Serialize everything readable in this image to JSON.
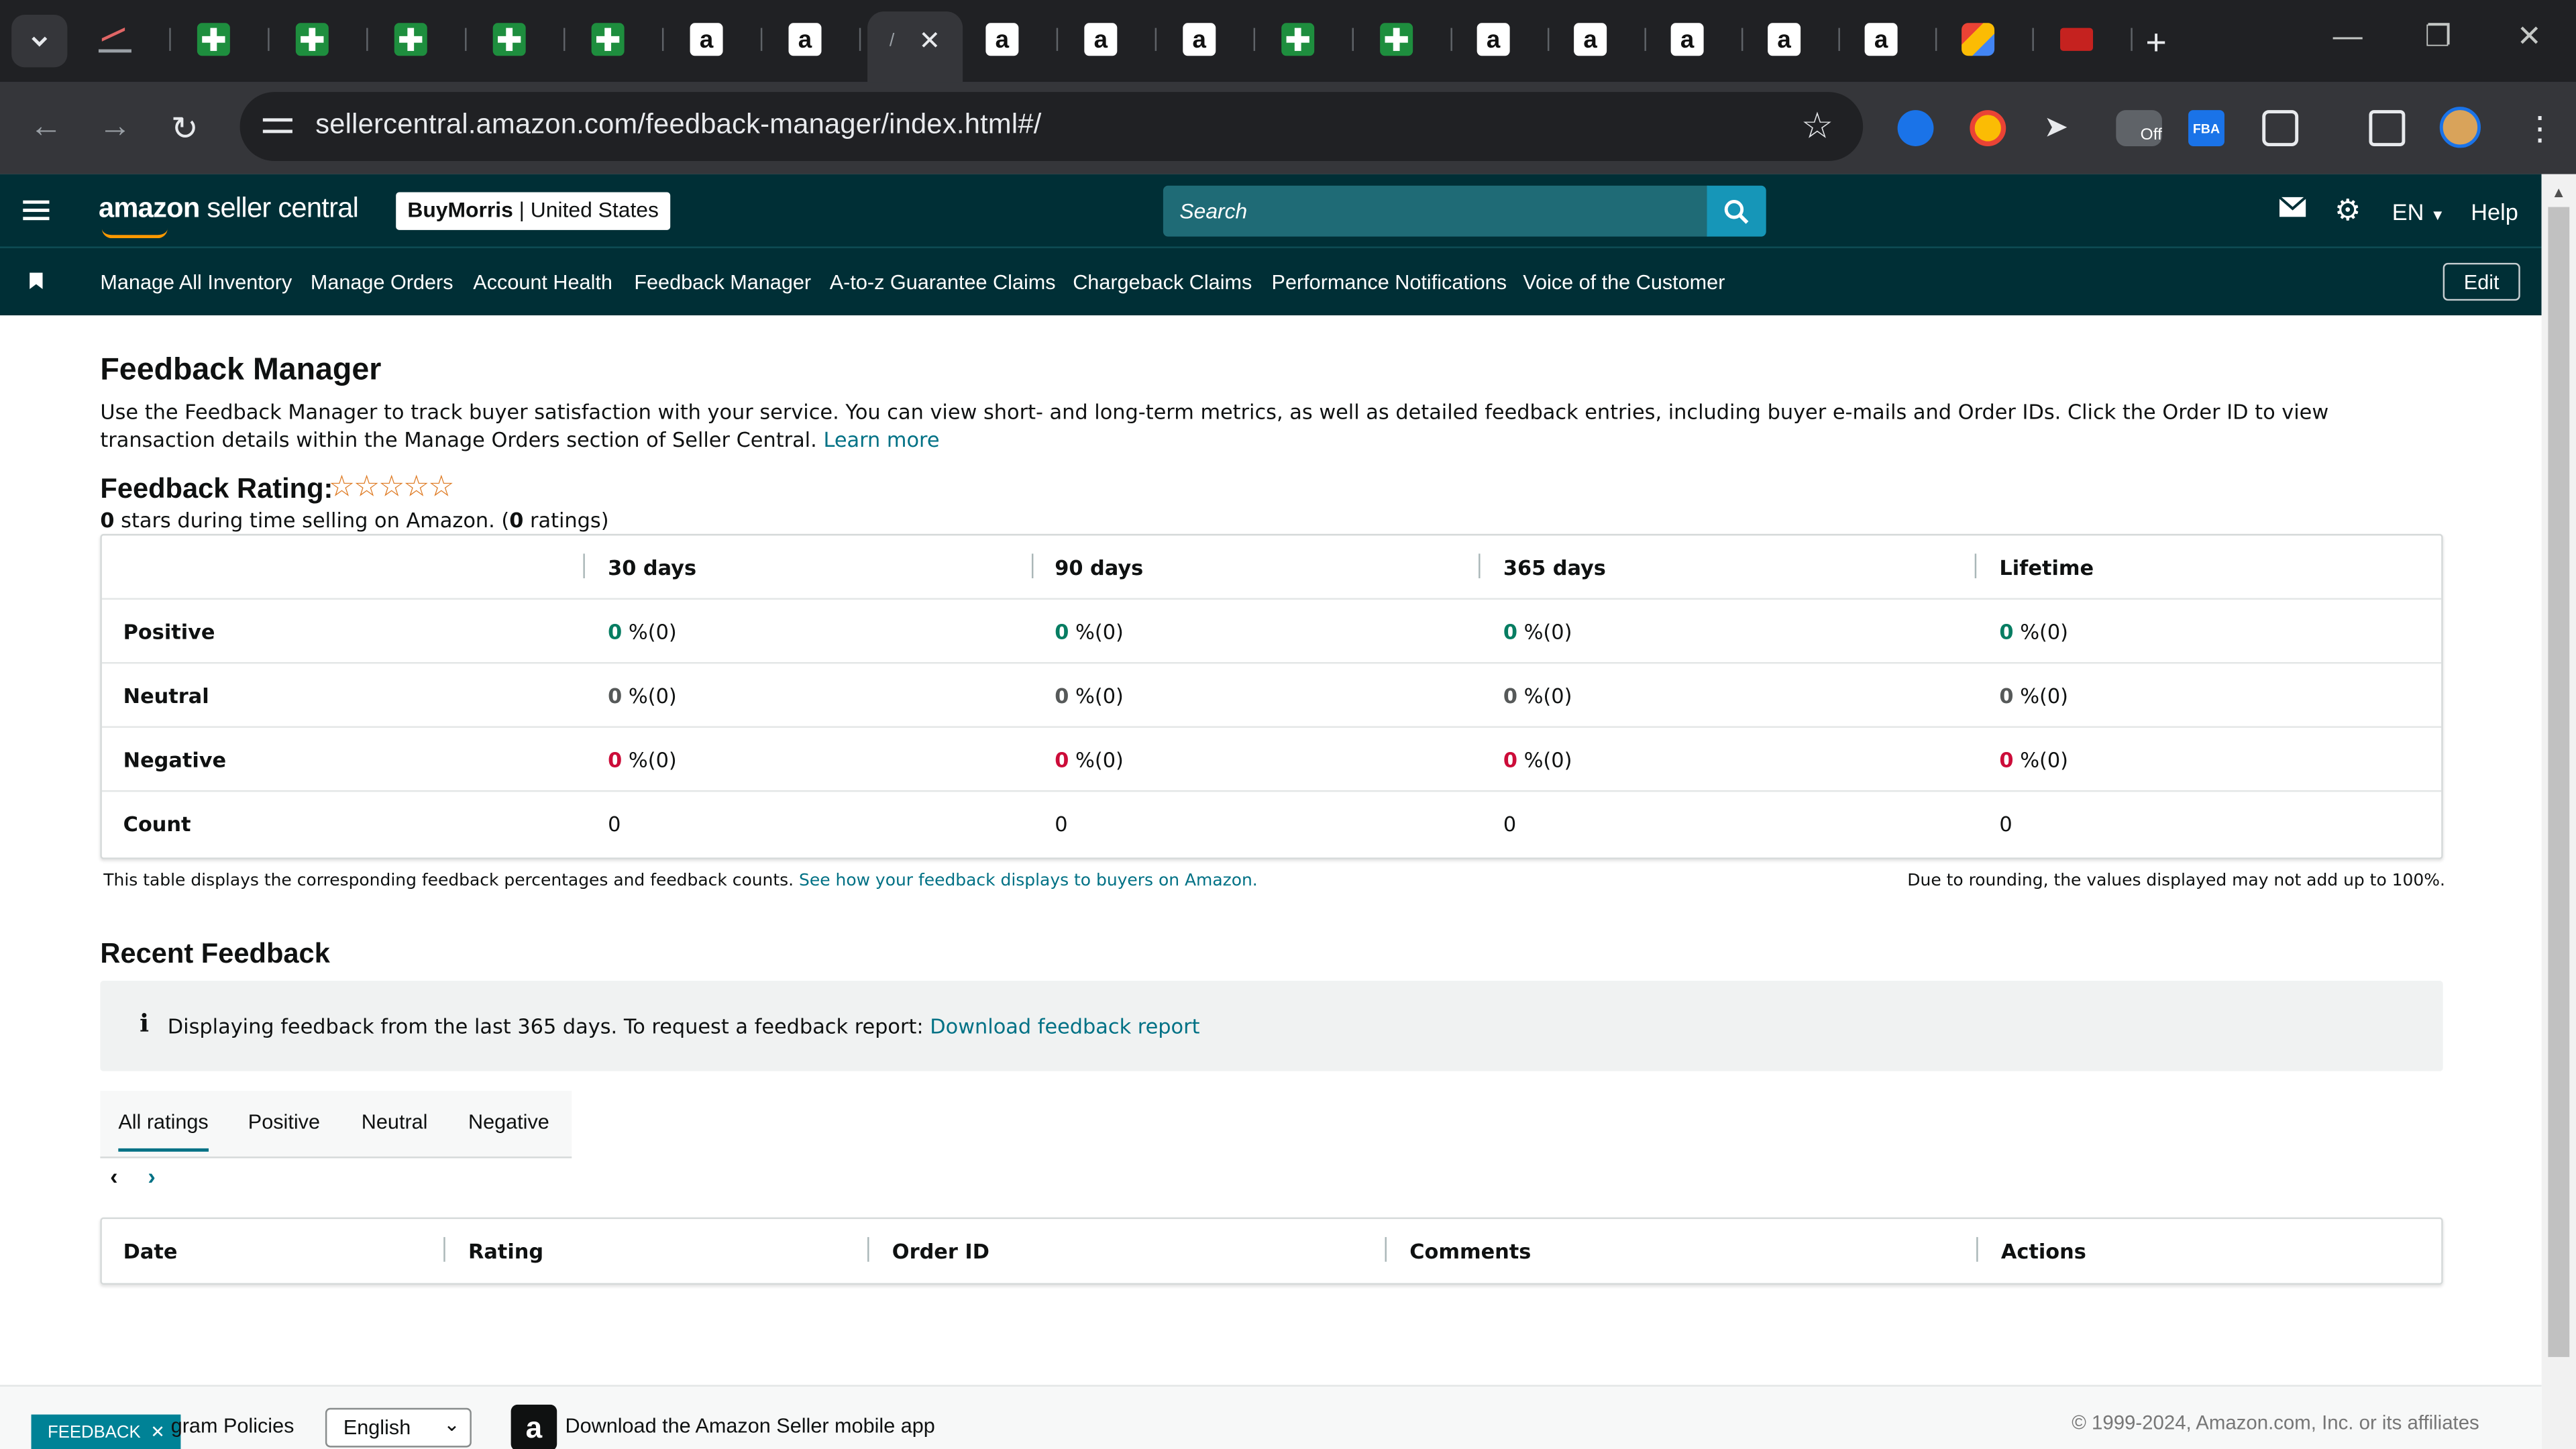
{
  "browser": {
    "url": "sellercentral.amazon.com/feedback-manager/index.html#/",
    "tabs": [
      {
        "icon": "chart-icon"
      },
      {
        "icon": "sheets-icon"
      },
      {
        "icon": "sheets-icon"
      },
      {
        "icon": "sheets-icon"
      },
      {
        "icon": "sheets-icon"
      },
      {
        "icon": "sheets-icon"
      },
      {
        "icon": "amazon-icon"
      },
      {
        "icon": "amazon-icon"
      },
      {
        "icon": "active"
      },
      {
        "icon": "amazon-icon"
      },
      {
        "icon": "amazon-icon"
      },
      {
        "icon": "amazon-icon"
      },
      {
        "icon": "sheets-icon"
      },
      {
        "icon": "sheets-icon"
      },
      {
        "icon": "amazon-icon"
      },
      {
        "icon": "amazon-icon"
      },
      {
        "icon": "amazon-icon"
      },
      {
        "icon": "amazon-icon"
      },
      {
        "icon": "amazon-icon"
      },
      {
        "icon": "multicolor-icon"
      },
      {
        "icon": "red-icon"
      }
    ],
    "extension_badge": "Off",
    "extension_fba": "FBA"
  },
  "header": {
    "logo_amazon": "amazon",
    "logo_rest": "seller central",
    "store_name": "BuyMorris",
    "marketplace": "United States",
    "search_placeholder": "Search",
    "language": "EN",
    "help": "Help"
  },
  "nav": {
    "items": [
      "Manage All Inventory",
      "Manage Orders",
      "Account Health",
      "Feedback Manager",
      "A-to-z Guarantee Claims",
      "Chargeback Claims",
      "Performance Notifications",
      "Voice of the Customer"
    ],
    "edit": "Edit"
  },
  "page": {
    "title": "Feedback Manager",
    "description": "Use the Feedback Manager to track buyer satisfaction with your service. You can view short- and long-term metrics, as well as detailed feedback entries, including buyer e-mails and Order IDs. Click the Order ID to view transaction details within the Manage Orders section of Seller Central.",
    "learn_more": "Learn more",
    "rating_title": "Feedback Rating:",
    "stars": "☆☆☆☆☆",
    "rating_value": "0",
    "rating_text_a": " stars during time selling on Amazon. (",
    "rating_count": "0",
    "rating_text_b": " ratings)"
  },
  "metrics": {
    "columns": [
      "30 days",
      "90 days",
      "365 days",
      "Lifetime"
    ],
    "rows": [
      {
        "label": "Positive",
        "values": [
          "0",
          "0",
          "0",
          "0"
        ],
        "suffix": " %(0)",
        "tone": "positive"
      },
      {
        "label": "Neutral",
        "values": [
          "0",
          "0",
          "0",
          "0"
        ],
        "suffix": " %(0)",
        "tone": "neutral"
      },
      {
        "label": "Negative",
        "values": [
          "0",
          "0",
          "0",
          "0"
        ],
        "suffix": " %(0)",
        "tone": "negative"
      },
      {
        "label": "Count",
        "values": [
          "0",
          "0",
          "0",
          "0"
        ],
        "suffix": "",
        "tone": "count"
      }
    ],
    "note_left": "This table displays the corresponding feedback percentages and feedback counts.",
    "note_link": "See how your feedback displays to buyers on Amazon.",
    "note_right": "Due to rounding, the values displayed may not add up to 100%."
  },
  "recent": {
    "title": "Recent Feedback",
    "alert_text": "Displaying feedback from the last 365 days. To request a feedback report:",
    "alert_link": "Download feedback report",
    "tabs": [
      "All ratings",
      "Positive",
      "Neutral",
      "Negative"
    ],
    "active_tab": "All ratings",
    "columns": [
      "Date",
      "Rating",
      "Order ID",
      "Comments",
      "Actions"
    ]
  },
  "footer": {
    "feedback_badge": "FEEDBACK",
    "policies": "gram Policies",
    "language": "English",
    "app_text": "Download the Amazon Seller mobile app",
    "copyright": "© 1999-2024, Amazon.com, Inc. or its affiliates"
  },
  "colors": {
    "header_bg": "#002f36",
    "link": "#007185",
    "positive": "#067d62",
    "negative": "#cc0c39",
    "search_button": "#1696b8"
  }
}
